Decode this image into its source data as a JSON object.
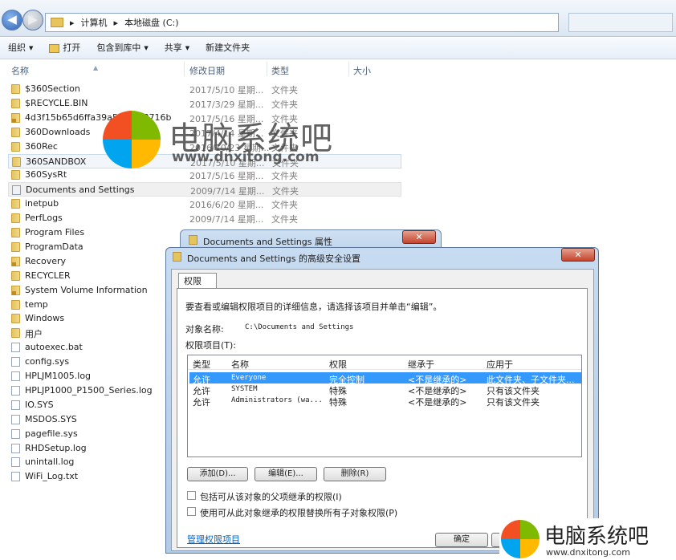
{
  "explorer": {
    "breadcrumb": [
      "计算机",
      "本地磁盘 (C:)"
    ],
    "toolbar": {
      "organize": "组织",
      "open": "打开",
      "include_library": "包含到库中",
      "share": "共享",
      "new_folder": "新建文件夹"
    },
    "columns": {
      "name": "名称",
      "date": "修改日期",
      "type": "类型",
      "size": "大小"
    },
    "files": [
      {
        "name": "$360Section",
        "date": "2017/5/10 星期...",
        "type": "文件夹",
        "icon": "folder-icon"
      },
      {
        "name": "$RECYCLE.BIN",
        "date": "2017/3/29 星期...",
        "type": "文件夹",
        "icon": "folder-icon"
      },
      {
        "name": "4d3f15b65d6ffa39a503e6f8716b",
        "date": "2017/5/16 星期...",
        "type": "文件夹",
        "icon": "locked-folder-icon"
      },
      {
        "name": "360Downloads",
        "date": "2017/4/14 星期...",
        "type": "文件夹",
        "icon": "folder-icon"
      },
      {
        "name": "360Rec",
        "date": "2016/10/23 星期...",
        "type": "文件夹",
        "icon": "folder-icon"
      },
      {
        "name": "360SANDBOX",
        "date": "2017/5/10 星期...",
        "type": "文件夹",
        "icon": "folder-icon"
      },
      {
        "name": "360SysRt",
        "date": "2017/5/16 星期...",
        "type": "文件夹",
        "icon": "folder-icon"
      },
      {
        "name": "Documents and Settings",
        "date": "2009/7/14 星期...",
        "type": "文件夹",
        "icon": "shortcut-folder-icon"
      },
      {
        "name": "inetpub",
        "date": "2016/6/20 星期...",
        "type": "文件夹",
        "icon": "folder-icon"
      },
      {
        "name": "PerfLogs",
        "date": "2009/7/14 星期...",
        "type": "文件夹",
        "icon": "folder-icon"
      },
      {
        "name": "Program Files",
        "date": "",
        "type": "",
        "icon": "folder-icon"
      },
      {
        "name": "ProgramData",
        "date": "",
        "type": "",
        "icon": "folder-icon"
      },
      {
        "name": "Recovery",
        "date": "",
        "type": "",
        "icon": "locked-folder-icon"
      },
      {
        "name": "RECYCLER",
        "date": "",
        "type": "",
        "icon": "folder-icon"
      },
      {
        "name": "System Volume Information",
        "date": "",
        "type": "",
        "icon": "locked-folder-icon"
      },
      {
        "name": "temp",
        "date": "",
        "type": "",
        "icon": "folder-icon"
      },
      {
        "name": "Windows",
        "date": "",
        "type": "",
        "icon": "folder-icon"
      },
      {
        "name": "用户",
        "date": "",
        "type": "",
        "icon": "folder-icon"
      },
      {
        "name": "autoexec.bat",
        "date": "",
        "type": "",
        "icon": "file-icon"
      },
      {
        "name": "config.sys",
        "date": "",
        "type": "",
        "icon": "file-icon"
      },
      {
        "name": "HPLJM1005.log",
        "date": "",
        "type": "",
        "icon": "file-icon"
      },
      {
        "name": "HPLJP1000_P1500_Series.log",
        "date": "",
        "type": "",
        "icon": "file-icon"
      },
      {
        "name": "IO.SYS",
        "date": "",
        "type": "",
        "icon": "file-icon"
      },
      {
        "name": "MSDOS.SYS",
        "date": "",
        "type": "",
        "icon": "file-icon"
      },
      {
        "name": "pagefile.sys",
        "date": "",
        "type": "",
        "icon": "file-icon"
      },
      {
        "name": "RHDSetup.log",
        "date": "",
        "type": "",
        "icon": "file-icon"
      },
      {
        "name": "unintall.log",
        "date": "",
        "type": "",
        "icon": "file-icon"
      },
      {
        "name": "WiFi_Log.txt",
        "date": "",
        "type": "",
        "icon": "file-icon"
      }
    ]
  },
  "watermark": {
    "title": "电脑系统吧",
    "url": "www.dnxitong.com"
  },
  "properties_dialog": {
    "title": "Documents and Settings 属性",
    "close": "✕"
  },
  "advanced_dialog": {
    "title": "Documents and Settings 的高级安全设置",
    "close": "✕",
    "tab": "权限",
    "instruction": "要查看或编辑权限项目的详细信息，请选择该项目并单击“编辑”。",
    "object_label": "对象名称:",
    "object_value": "C:\\Documents and Settings",
    "entries_label": "权限项目(T):",
    "headers": {
      "type": "类型",
      "name": "名称",
      "perm": "权限",
      "inherited": "继承于",
      "applies": "应用于"
    },
    "rows": [
      {
        "type": "允许",
        "name": "Everyone",
        "perm": "完全控制",
        "inherited": "<不是继承的>",
        "applies": "此文件夹、子文件夹..."
      },
      {
        "type": "允许",
        "name": "SYSTEM",
        "perm": "特殊",
        "inherited": "<不是继承的>",
        "applies": "只有该文件夹"
      },
      {
        "type": "允许",
        "name": "Administrators (wa...",
        "perm": "特殊",
        "inherited": "<不是继承的>",
        "applies": "只有该文件夹"
      }
    ],
    "add_button": "添加(D)...",
    "edit_button": "编辑(E)...",
    "delete_button": "删除(R)",
    "inherit_checkbox": "包括可从该对象的父项继承的权限(I)",
    "replace_checkbox": "使用可从此对象继承的权限替换所有子对象权限(P)",
    "manage_link": "管理权限项目",
    "ok_button": "确定"
  },
  "brand": {
    "title": "电脑系统吧",
    "url": "www.dnxitong.com"
  },
  "colors": {
    "selection": "#3399ff",
    "link": "#0066cc",
    "close_red": "#c4442d",
    "logo_red": "#f25022",
    "logo_green": "#7fba00",
    "logo_blue": "#00a4ef",
    "logo_yellow": "#ffb900"
  }
}
